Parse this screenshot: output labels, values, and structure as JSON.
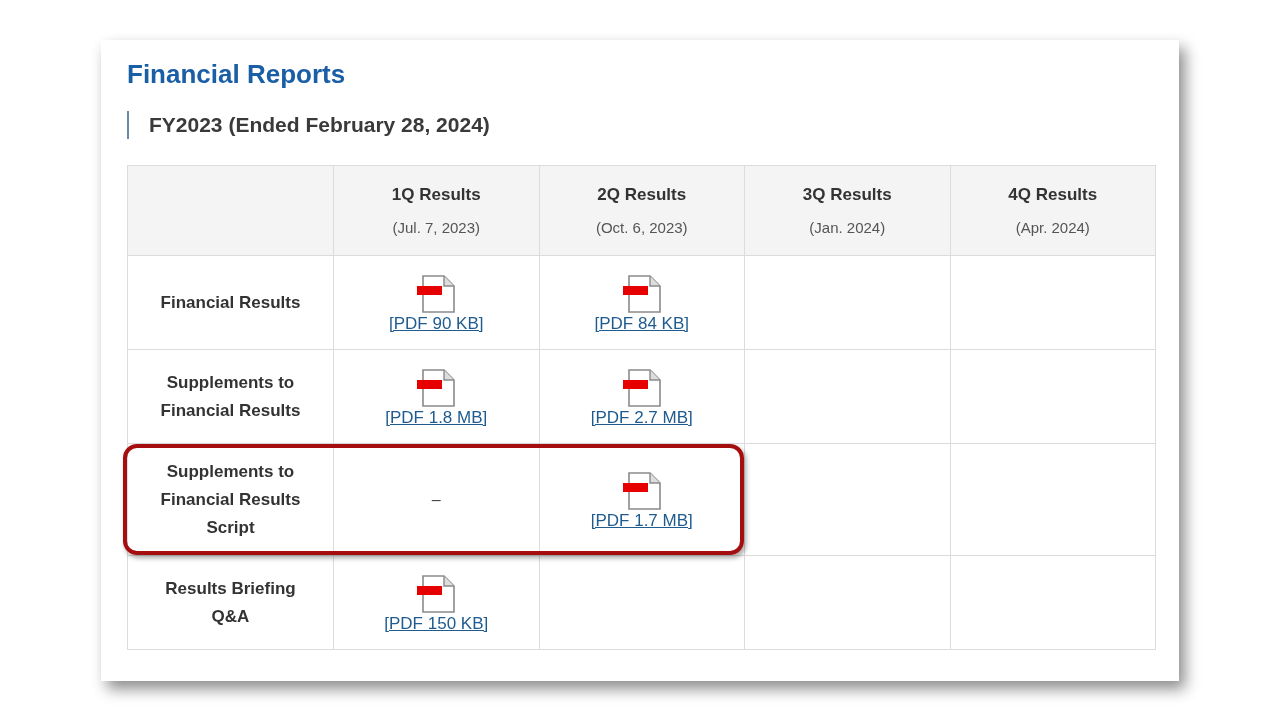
{
  "title": "Financial Reports",
  "section": {
    "heading": "FY2023 (Ended February 28, 2024)"
  },
  "table": {
    "columns": [
      {
        "title": "1Q Results",
        "date": "(Jul. 7, 2023)"
      },
      {
        "title": "2Q Results",
        "date": "(Oct. 6, 2023)"
      },
      {
        "title": "3Q Results",
        "date": "(Jan. 2024)"
      },
      {
        "title": "4Q Results",
        "date": "(Apr. 2024)"
      }
    ],
    "rows": [
      {
        "label": "Financial Results",
        "highlighted": false,
        "cells": [
          {
            "kind": "pdf",
            "text": "[PDF 90 KB]"
          },
          {
            "kind": "pdf",
            "text": "[PDF 84 KB]"
          },
          {
            "kind": "empty"
          },
          {
            "kind": "empty"
          }
        ]
      },
      {
        "label": "Supplements to Financial Results",
        "highlighted": false,
        "cells": [
          {
            "kind": "pdf",
            "text": "[PDF 1.8 MB]"
          },
          {
            "kind": "pdf",
            "text": "[PDF 2.7 MB]"
          },
          {
            "kind": "empty"
          },
          {
            "kind": "empty"
          }
        ]
      },
      {
        "label": "Supplements to Financial Results Script",
        "highlighted": true,
        "cells": [
          {
            "kind": "dash",
            "text": "–"
          },
          {
            "kind": "pdf",
            "text": "[PDF 1.7 MB]"
          },
          {
            "kind": "empty"
          },
          {
            "kind": "empty"
          }
        ]
      },
      {
        "label": "Results Briefing Q&A",
        "highlighted": false,
        "cells": [
          {
            "kind": "pdf",
            "text": "[PDF 150 KB]"
          },
          {
            "kind": "empty"
          },
          {
            "kind": "empty"
          },
          {
            "kind": "empty"
          }
        ]
      }
    ]
  }
}
